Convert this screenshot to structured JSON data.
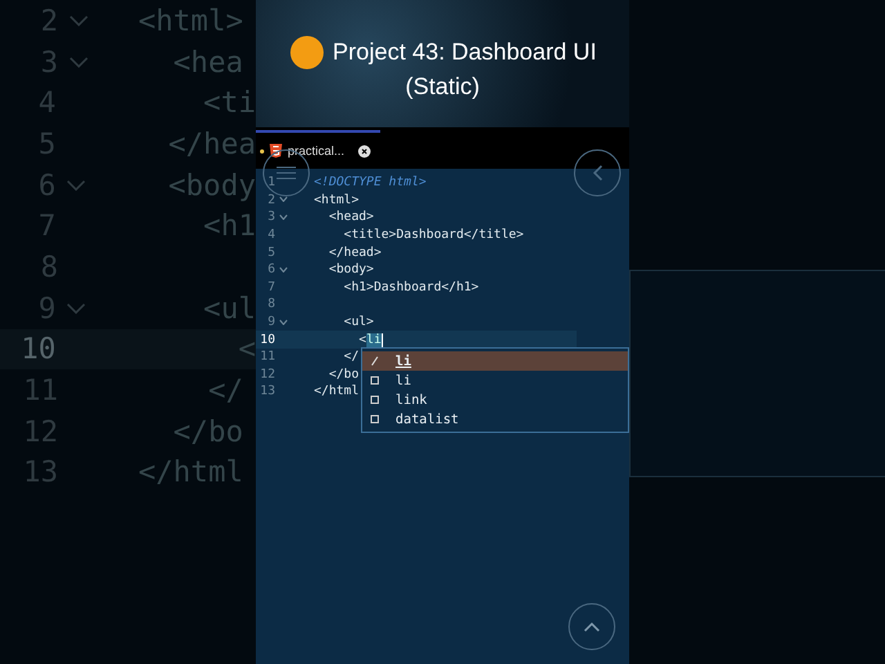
{
  "background_code": [
    {
      "number": "2",
      "text": "<html>",
      "foldable": true,
      "active": false
    },
    {
      "number": "3",
      "text": "  <hea",
      "foldable": true,
      "active": false
    },
    {
      "number": "4",
      "text": "    <ti",
      "foldable": false,
      "active": false
    },
    {
      "number": "5",
      "text": "  </hea",
      "foldable": false,
      "active": false
    },
    {
      "number": "6",
      "text": "  <body",
      "foldable": true,
      "active": false
    },
    {
      "number": "7",
      "text": "    <h1",
      "foldable": false,
      "active": false
    },
    {
      "number": "8",
      "foldable": false,
      "active": false
    },
    {
      "number": "9",
      "text": "    <ul",
      "foldable": true,
      "active": false
    },
    {
      "number": "10",
      "text": "      <",
      "foldable": false,
      "active": true
    },
    {
      "number": "11",
      "text": "    </",
      "foldable": false,
      "active": false
    },
    {
      "number": "12",
      "text": "  </bo",
      "foldable": false,
      "active": false
    },
    {
      "number": "13",
      "text": "</html",
      "foldable": false,
      "active": false
    }
  ],
  "header": {
    "title_lines": [
      "Project 43: Dashboard UI",
      "(Static)"
    ]
  },
  "tab": {
    "label": "practical...",
    "modified": true
  },
  "code": [
    {
      "number": "1",
      "text": "<!DOCTYPE html>",
      "kind": "doctype",
      "foldable": false,
      "active": false
    },
    {
      "number": "2",
      "text": "<html>",
      "kind": "tag",
      "foldable": true,
      "active": false
    },
    {
      "number": "3",
      "text": "  <head>",
      "kind": "tag",
      "foldable": true,
      "active": false
    },
    {
      "number": "4",
      "text": "    <title>Dashboard</title>",
      "kind": "tag",
      "foldable": false,
      "active": false
    },
    {
      "number": "5",
      "text": "  </head>",
      "kind": "tag",
      "foldable": false,
      "active": false
    },
    {
      "number": "6",
      "text": "  <body>",
      "kind": "tag",
      "foldable": true,
      "active": false
    },
    {
      "number": "7",
      "text": "    <h1>Dashboard</h1>",
      "kind": "tag",
      "foldable": false,
      "active": false
    },
    {
      "number": "8",
      "foldable": false,
      "active": false
    },
    {
      "number": "9",
      "text": "    <ul>",
      "kind": "tag",
      "foldable": true,
      "active": false
    },
    {
      "number": "10",
      "text": "      <",
      "match": "li",
      "kind": "tag",
      "foldable": false,
      "active": true
    },
    {
      "number": "11",
      "text": "    </",
      "kind": "tag",
      "foldable": false,
      "active": false
    },
    {
      "number": "12",
      "text": "  </bo",
      "kind": "tag",
      "foldable": false,
      "active": false
    },
    {
      "number": "13",
      "text": "</html",
      "kind": "tag",
      "foldable": false,
      "active": false
    }
  ],
  "suggestions": [
    {
      "label": "li",
      "kind": "snippet",
      "selected": true
    },
    {
      "label": "li",
      "kind": "tag",
      "selected": false
    },
    {
      "label": "link",
      "kind": "tag",
      "selected": false
    },
    {
      "label": "datalist",
      "kind": "tag",
      "selected": false
    }
  ]
}
